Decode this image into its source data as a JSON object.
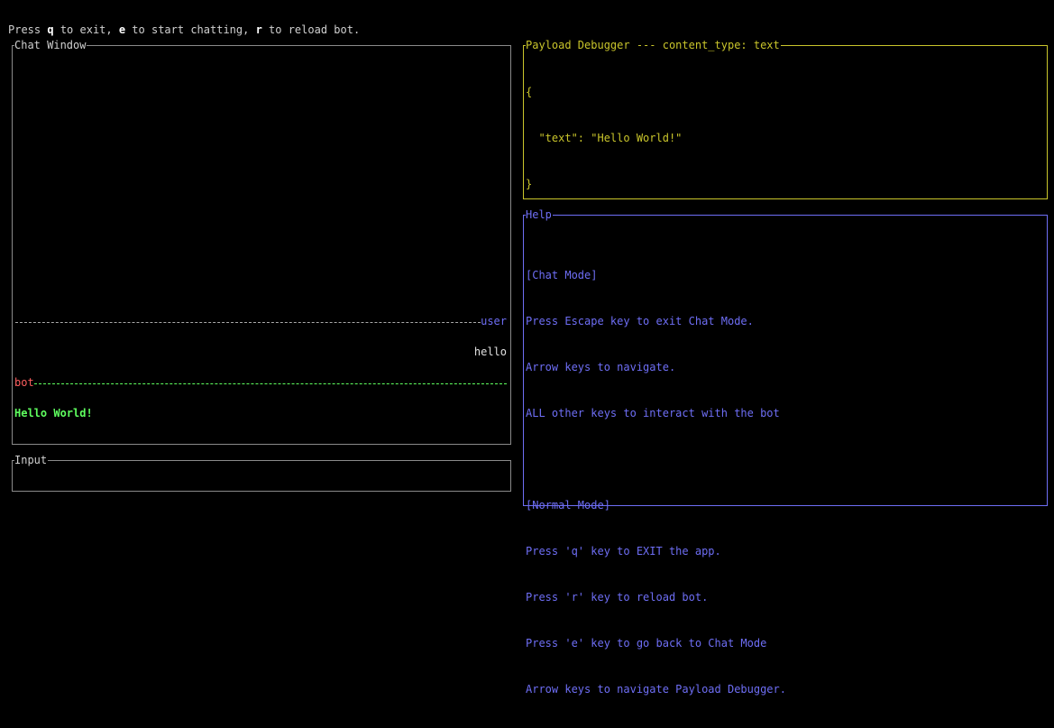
{
  "header": {
    "prefix": "Press ",
    "key_q": "q",
    "mid1": " to exit, ",
    "key_e": "e",
    "mid2": " to start chatting, ",
    "key_r": "r",
    "suffix": " to reload bot."
  },
  "chat_window": {
    "title": "Chat Window",
    "messages": [
      {
        "sender": "user",
        "text": "hello"
      },
      {
        "sender": "bot",
        "text": "Hello World!"
      }
    ]
  },
  "input": {
    "title": "Input",
    "value": ""
  },
  "payload_debugger": {
    "title": "Payload Debugger --- content_type: text",
    "lines": [
      "{",
      "  \"text\": \"Hello World!\"",
      "}"
    ]
  },
  "help": {
    "title": "Help",
    "lines": [
      "[Chat Mode]",
      "Press Escape key to exit Chat Mode.",
      "Arrow keys to navigate.",
      "ALL other keys to interact with the bot",
      "",
      "[Normal Mode]",
      "Press 'q' key to EXIT the app.",
      "Press 'r' key to reload bot.",
      "Press 'e' key to go back to Chat Mode",
      "Arrow keys to navigate Payload Debugger."
    ]
  },
  "colors": {
    "user": "#6e6ef5",
    "bot": "#ff5f5f",
    "bot_text": "#5fff5f",
    "payload": "#c9c52b",
    "help": "#6e6ef5",
    "border": "#8a8a8a"
  }
}
